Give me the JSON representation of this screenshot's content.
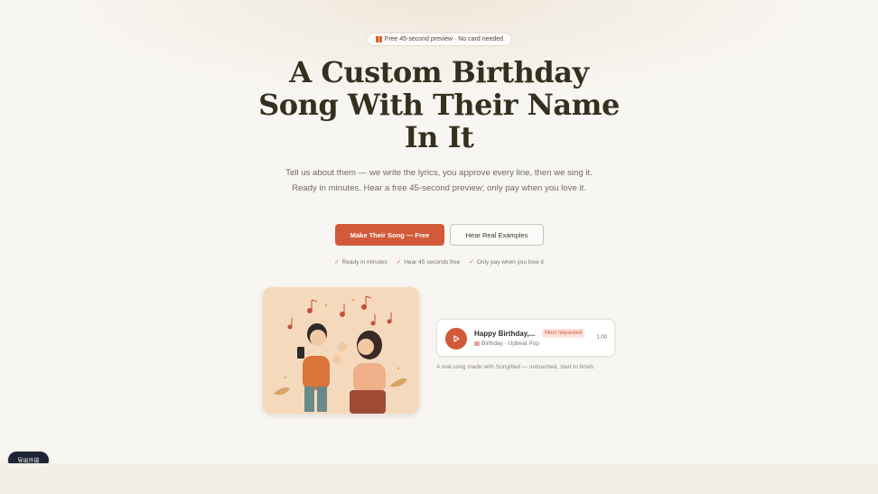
{
  "hero": {
    "badge": "Free 45-second preview · No card needed",
    "badge_icon": "gift-icon",
    "title": "A Custom Birthday Song With Their Name In It",
    "subtitle": "Tell us about them — we write the lyrics, you approve every line, then we sing it. Ready in minutes. Hear a free 45-second preview; only pay when you love it.",
    "primary_cta": "Make Their Song — Free",
    "secondary_cta": "Hear Real Examples",
    "benefits": [
      "Ready in minutes",
      "Hear 45 seconds free",
      "Only pay when you love it"
    ]
  },
  "sample": {
    "illustration_alt": "illustration of two people singing",
    "song_title": "Happy Birthday,...",
    "tag": "Most requested",
    "meta": "Birthday · Upbeat Pop",
    "duration": "1:00",
    "caption": "A real song made with Songified — untouched, start to finish."
  },
  "widget": {
    "export_label": "导出外链"
  },
  "colors": {
    "accent": "#d25a3b",
    "background": "#f8f6f2",
    "title": "#34301f"
  }
}
